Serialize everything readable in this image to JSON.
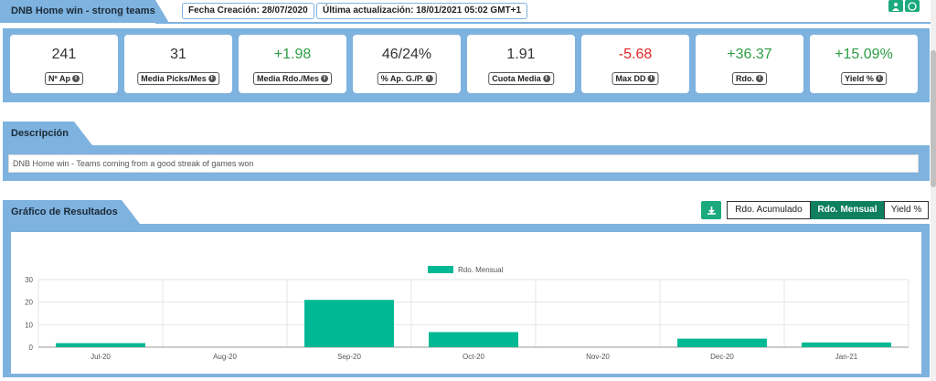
{
  "header": {
    "title": "DNB Home win - strong teams",
    "fecha_creacion": "Fecha Creación: 28/07/2020",
    "ultima_actualizacion": "Última actualización: 18/01/2021 05:02 GMT+1"
  },
  "stats": [
    {
      "value": "241",
      "label": "Nº Ap",
      "tone": "neutral"
    },
    {
      "value": "31",
      "label": "Media Picks/Mes",
      "tone": "neutral"
    },
    {
      "value": "+1.98",
      "label": "Media Rdo./Mes",
      "tone": "pos"
    },
    {
      "value": "46/24%",
      "label": "% Ap. G./P.",
      "tone": "neutral"
    },
    {
      "value": "1.91",
      "label": "Cuota Media",
      "tone": "neutral"
    },
    {
      "value": "-5.68",
      "label": "Max DD",
      "tone": "neg"
    },
    {
      "value": "+36.37",
      "label": "Rdo.",
      "tone": "pos"
    },
    {
      "value": "+15.09%",
      "label": "Yield %",
      "tone": "pos"
    }
  ],
  "description": {
    "heading": "Descripción",
    "text": "DNB Home win - Teams coming from a good streak of games won"
  },
  "chart_section": {
    "heading": "Gráfico de Resultados",
    "toggles": [
      {
        "label": "Rdo. Acumulado",
        "active": false
      },
      {
        "label": "Rdo. Mensual",
        "active": true
      },
      {
        "label": "Yield %",
        "active": false
      }
    ]
  },
  "colors": {
    "band": "#7eb2df",
    "bar": "#00b894",
    "positive": "#2e9d44",
    "negative": "#e42424",
    "button": "#1aaa7e"
  },
  "chart_data": {
    "type": "bar",
    "categories": [
      "Jul-20",
      "Aug-20",
      "Sep-20",
      "Oct-20",
      "Nov-20",
      "Dec-20",
      "Jan-21"
    ],
    "series": [
      {
        "name": "Rdo. Mensual",
        "values": [
          1.8,
          0,
          21,
          6.7,
          0,
          3.8,
          2.1
        ]
      }
    ],
    "ylim": [
      0,
      30
    ],
    "yticks": [
      0,
      10,
      20,
      30
    ],
    "grid": true,
    "legend": "top-center"
  }
}
